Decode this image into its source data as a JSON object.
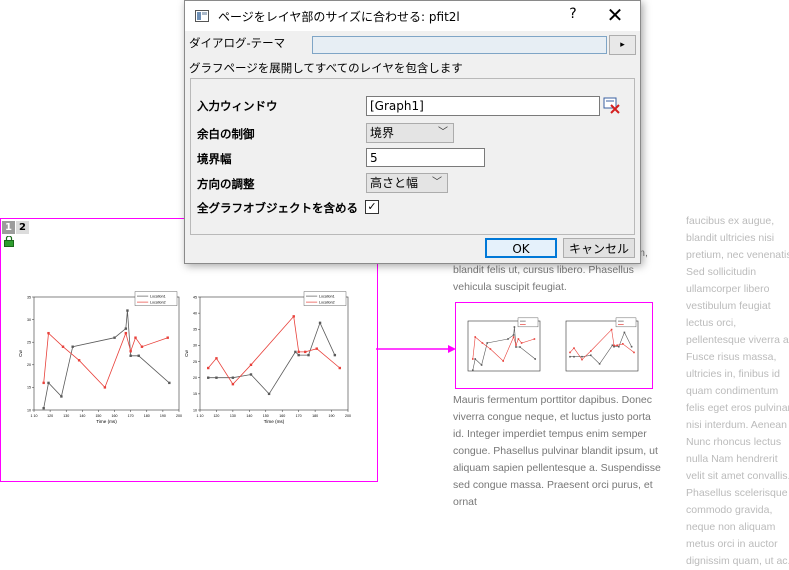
{
  "dialog": {
    "title": "ページをレイヤ部のサイズに合わせる: pfit2l",
    "help_label": "?",
    "close_label": "✕",
    "theme_label": "ダイアログ-テーマ",
    "theme_value": "",
    "theme_button": "▸",
    "description": "グラフページを展開してすべてのレイヤを包含します",
    "fields": {
      "input_window_label": "入力ウィンドウ",
      "input_window_value": "[Graph1]",
      "margin_label": "余白の制御",
      "margin_value": "境界",
      "border_width_label": "境界幅",
      "border_width_value": "5",
      "direction_label": "方向の調整",
      "direction_value": "高さと幅",
      "include_all_label": "全グラフオブジェクトを含める",
      "include_all_checked": "✓"
    },
    "ok_label": "OK",
    "cancel_label": "キャンセル"
  },
  "graph": {
    "tabs": [
      "1",
      "2"
    ],
    "legend": [
      "Location1",
      "Location2"
    ],
    "xlabel": "Time (ms)",
    "ylabel": "Cw"
  },
  "colors": {
    "magenta": "#ff00ff",
    "series1": "#5a5a5a",
    "series2": "#e8403a",
    "ok_border": "#0078d7"
  },
  "document": {
    "mid_top": "ultricies hendrerit. Proin vel ligula pretium, blandit felis ut, cursus libero. Phasellus vehicula suscipit feugiat.",
    "mid_bottom": "Mauris fermentum porttitor dapibus. Donec viverra congue neque, et luctus justo porta id. Integer imperdiet tempus enim semper congue. Phasellus pulvinar blandit ipsum, ut aliquam sapien pellentesque a. Suspendisse sed congue massa. Praesent orci purus, et ornat",
    "right": "faucibus ex augue, blandit ultricies nisi pretium, nec venenatis. Sed sollicitudin ullamcorper libero vestibulum feugiat lectus orci, pellentesque viverra a. Fusce risus massa, ultricies in, finibus id quam condimentum felis eget eros pulvinar nisi interdum. Aenean Nunc rhoncus lectus nulla Nam hendrerit velit sit amet convallis. Phasellus scelerisque commodo gravida, neque non aliquam metus orci in auctor dignissim quam, ut ac."
  },
  "chart_data": [
    {
      "type": "line",
      "xlim": [
        110,
        200
      ],
      "ylim": [
        10,
        35
      ],
      "x_ticks": [
        "1 10",
        "120",
        "130",
        "140",
        "150",
        "160",
        "170",
        "180",
        "190",
        "200"
      ],
      "y_ticks": [
        "10",
        "15",
        "20",
        "25",
        "30",
        "35"
      ],
      "series": [
        {
          "name": "Location1",
          "x": [
            116,
            119,
            127,
            134,
            160,
            167,
            168,
            170,
            175,
            194
          ],
          "y": [
            10.4,
            16,
            13,
            24,
            26,
            28,
            32,
            22,
            22,
            16
          ]
        },
        {
          "name": "Location2",
          "x": [
            116,
            119,
            128,
            138,
            154,
            167,
            170,
            173,
            177,
            193
          ],
          "y": [
            16,
            27,
            24,
            21,
            15,
            27,
            23,
            26,
            24,
            26
          ]
        }
      ]
    },
    {
      "type": "line",
      "xlim": [
        110,
        200
      ],
      "ylim": [
        10,
        45
      ],
      "x_ticks": [
        "1 10",
        "120",
        "130",
        "140",
        "150",
        "160",
        "170",
        "180",
        "190",
        "200"
      ],
      "y_ticks": [
        "10",
        "15",
        "20",
        "25",
        "30",
        "35",
        "40",
        "45"
      ],
      "series": [
        {
          "name": "Location1",
          "x": [
            115,
            120,
            130,
            141,
            152,
            168,
            170,
            176,
            183,
            192
          ],
          "y": [
            20,
            20,
            20,
            21,
            15,
            28,
            27,
            27,
            37,
            27
          ]
        },
        {
          "name": "Location2",
          "x": [
            115,
            120,
            130,
            141,
            167,
            170,
            174,
            181,
            195
          ],
          "y": [
            23,
            26,
            18,
            24,
            39,
            28,
            28,
            29,
            23
          ]
        }
      ]
    }
  ]
}
